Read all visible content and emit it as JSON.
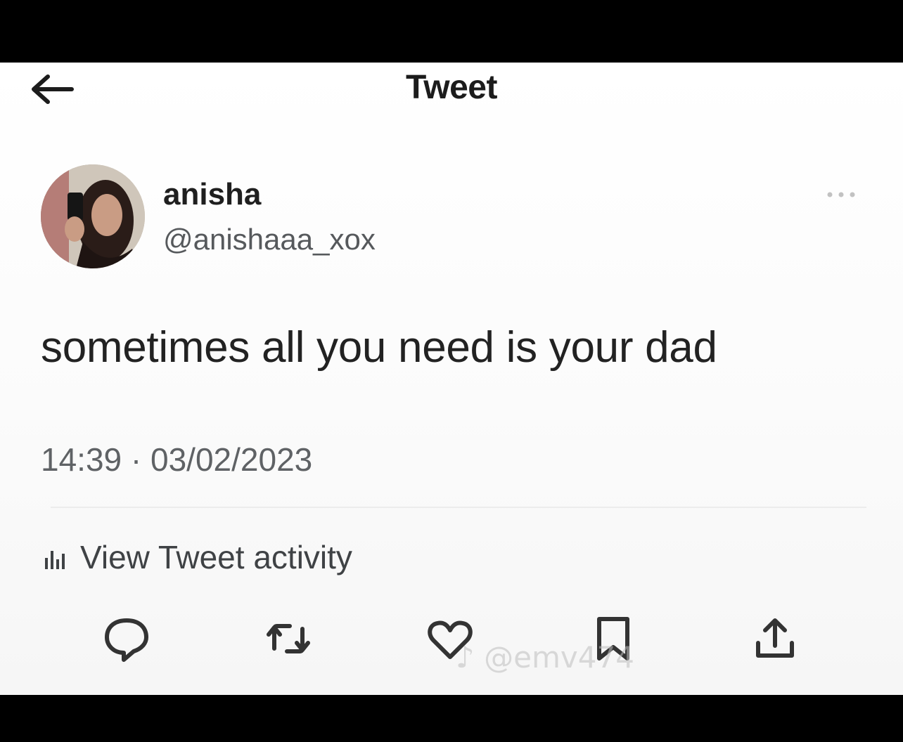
{
  "header": {
    "title": "Tweet"
  },
  "author": {
    "display_name": "anisha",
    "handle": "@anishaaa_xox"
  },
  "tweet": {
    "text": "sometimes all you need is your dad",
    "time": "14:39",
    "separator": "·",
    "date": "03/02/2023"
  },
  "activity": {
    "label": "View Tweet activity"
  },
  "watermark": {
    "text": "@emv474"
  },
  "icons": {
    "back": "back-arrow-icon",
    "more": "more-dots-icon",
    "activity": "bar-chart-icon",
    "reply": "reply-bubble-icon",
    "retweet": "retweet-icon",
    "like": "heart-icon",
    "bookmark": "bookmark-icon",
    "share": "share-icon"
  },
  "colors": {
    "text": "#222222",
    "secondary": "#5f6265",
    "icon": "#333333"
  }
}
